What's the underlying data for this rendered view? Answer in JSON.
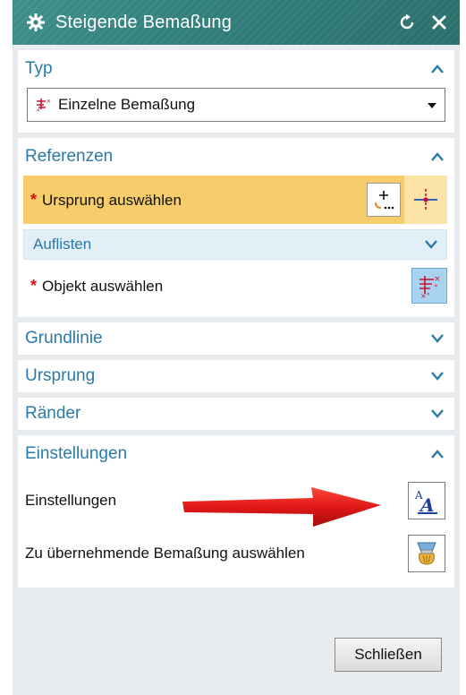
{
  "dialog": {
    "title": "Steigende Bemaßung",
    "title_icons": [
      "gear-icon",
      "reset-icon",
      "close-icon"
    ]
  },
  "sections": {
    "typ": {
      "header": "Typ",
      "selected": "Einzelne Bemaßung"
    },
    "referenzen": {
      "header": "Referenzen",
      "origin_label": "Ursprung auswählen",
      "list_label": "Auflisten",
      "object_label": "Objekt auswählen"
    },
    "grundlinie": {
      "header": "Grundlinie"
    },
    "ursprung": {
      "header": "Ursprung"
    },
    "raender": {
      "header": "Ränder"
    },
    "einstellungen": {
      "header": "Einstellungen",
      "settings_label": "Einstellungen",
      "inherit_label": "Zu übernehmende Bemaßung auswählen"
    }
  },
  "footer": {
    "close_label": "Schließen"
  },
  "colors": {
    "title_bar": "#2f7c78",
    "section_header_text": "#2a7aa8",
    "active_row": "#f7cc6a",
    "required_star": "#d40f0f",
    "selected_button": "#a9d4f0",
    "annotation_arrow": "#e01818"
  }
}
